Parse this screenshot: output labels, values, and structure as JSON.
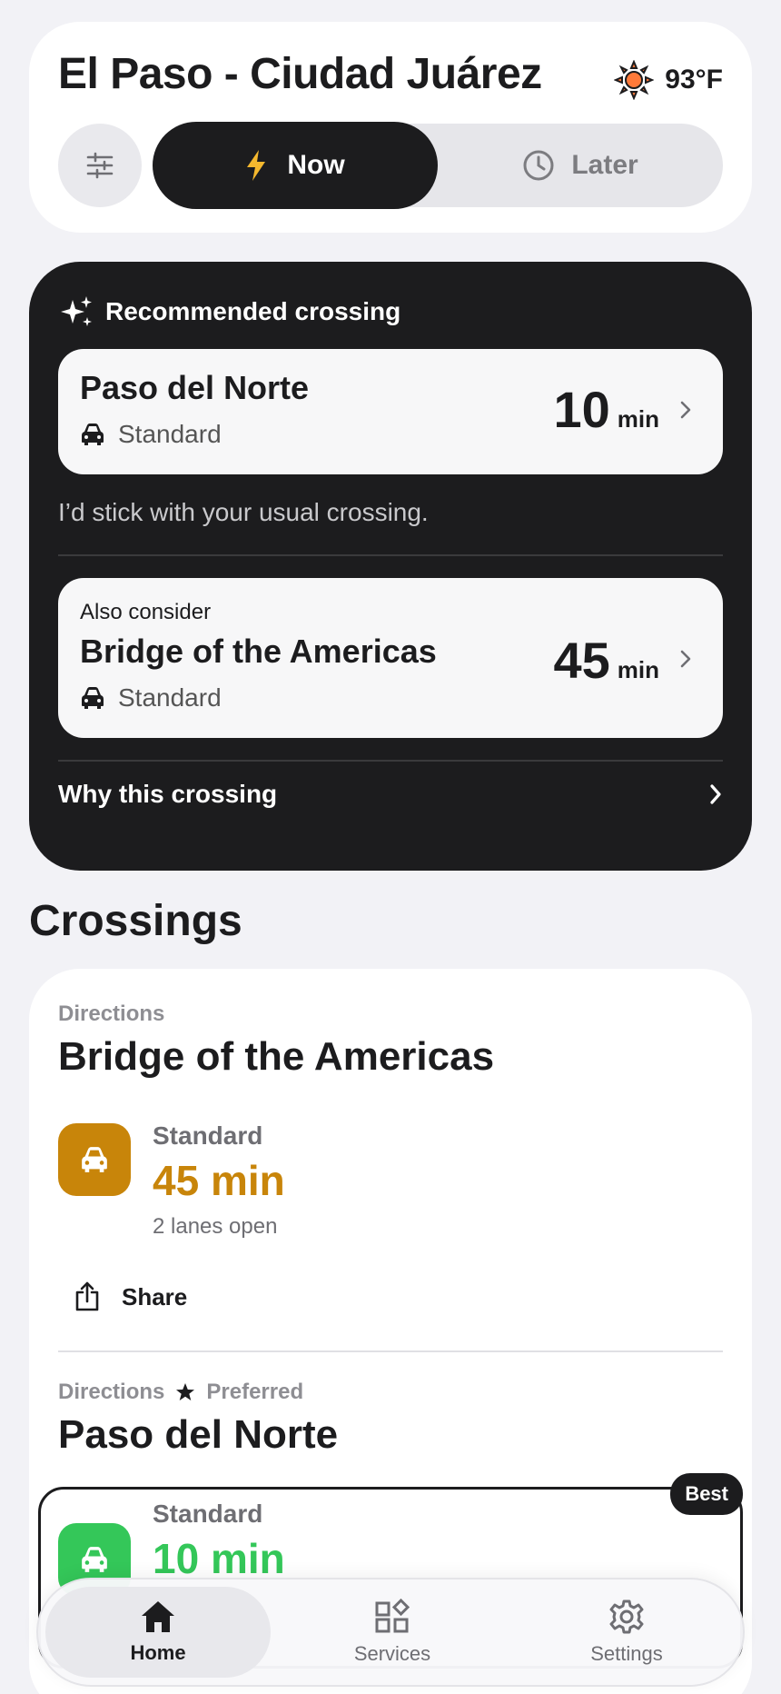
{
  "header": {
    "title": "El Paso - Ciudad Juárez",
    "temperature": "93°F",
    "weather_icon": "sun-icon",
    "segments": {
      "now": "Now",
      "later": "Later"
    }
  },
  "recommended": {
    "heading": "Recommended crossing",
    "primary": {
      "name": "Paso del Norte",
      "lane": "Standard",
      "wait": "10",
      "unit": "min"
    },
    "note": "I’d stick with your usual crossing.",
    "alternate": {
      "eyebrow": "Also consider",
      "name": "Bridge of the Americas",
      "lane": "Standard",
      "wait": "45",
      "unit": "min"
    },
    "why": "Why this crossing"
  },
  "crossings": {
    "title": "Crossings",
    "items": [
      {
        "label": "Directions",
        "name": "Bridge of the Americas",
        "lane": "Standard",
        "wait": "45 min",
        "lanes_open": "2 lanes open",
        "share": "Share",
        "color": "#c8850a"
      },
      {
        "label": "Directions",
        "preferred": "Preferred",
        "name": "Paso del Norte",
        "lane": "Standard",
        "wait": "10 min",
        "badge": "Best",
        "color": "#34c759"
      }
    ]
  },
  "tabs": [
    {
      "label": "Home",
      "icon": "home-icon"
    },
    {
      "label": "Services",
      "icon": "services-icon"
    },
    {
      "label": "Settings",
      "icon": "gear-icon"
    }
  ]
}
